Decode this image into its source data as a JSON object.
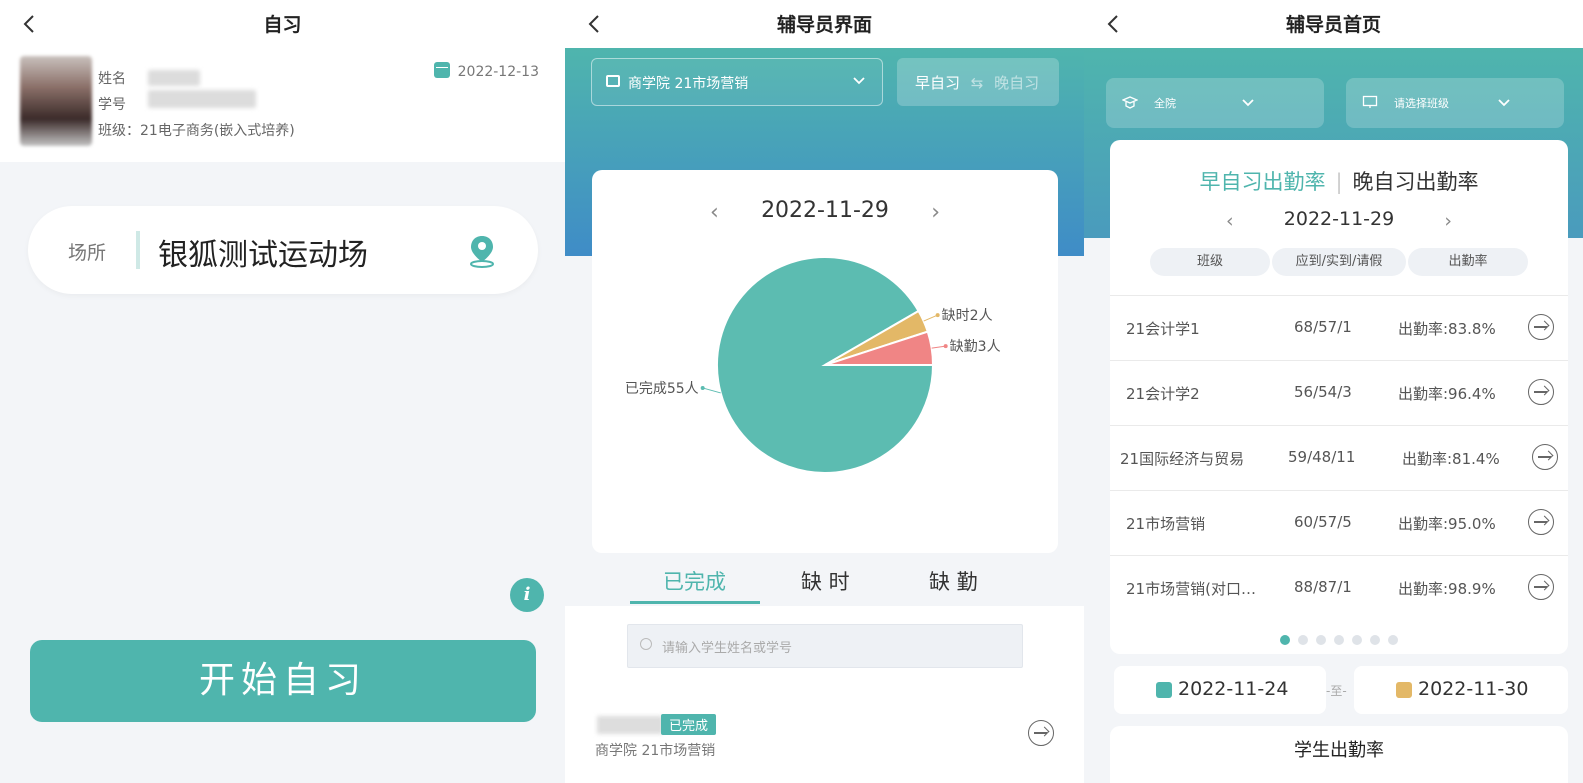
{
  "panel1": {
    "title": "自习",
    "name_label": "姓名",
    "id_label": "学号",
    "class_line": "班级：21电子商务(嵌入式培养)",
    "date": "2022-12-13",
    "venue_label": "场所",
    "venue_value": "银狐测试运动场",
    "info_icon_glyph": "i",
    "start_button": "开始自习"
  },
  "panel2": {
    "title": "辅导员界面",
    "class_select": "商学院 21市场营销",
    "session_active": "早自习",
    "session_inactive": "晚自习",
    "date": "2022-11-29",
    "tabs": [
      "已完成",
      "缺 时",
      "缺 勤"
    ],
    "search_placeholder": "请输入学生姓名或学号",
    "record": {
      "badge": "已完成",
      "class": "商学院 21市场营销"
    }
  },
  "chart_data": {
    "type": "pie",
    "title": "",
    "slices": [
      {
        "label": "已完成55人",
        "value": 55,
        "color": "#5cbcb1"
      },
      {
        "label": "缺时2人",
        "value": 2,
        "color": "#e3b867"
      },
      {
        "label": "缺勤3人",
        "value": 3,
        "color": "#f08585"
      }
    ]
  },
  "panel3": {
    "title": "辅导员首页",
    "college_filter": "全院",
    "class_filter": "请选择班级",
    "tab_active": "早自习出勤率",
    "tab_inactive": "晚自习出勤率",
    "date": "2022-11-29",
    "headers": [
      "班级",
      "应到/实到/请假",
      "出勤率"
    ],
    "rows": [
      {
        "class": "21会计学1",
        "counts": "68/57/1",
        "rate": "出勤率:83.8%"
      },
      {
        "class": "21会计学2",
        "counts": "56/54/3",
        "rate": "出勤率:96.4%"
      },
      {
        "class": "21国际经济与贸易",
        "counts": "59/48/11",
        "rate": "出勤率:81.4%"
      },
      {
        "class": "21市场营销",
        "counts": "60/57/5",
        "rate": "出勤率:95.0%"
      },
      {
        "class": "21市场营销(对口…",
        "counts": "88/87/1",
        "rate": "出勤率:98.9%"
      }
    ],
    "page_count": 7,
    "active_page": 1,
    "start_date": "2022-11-24",
    "range_sep": "-至-",
    "end_date": "2022-11-30",
    "student_rate_title": "学生出勤率"
  }
}
